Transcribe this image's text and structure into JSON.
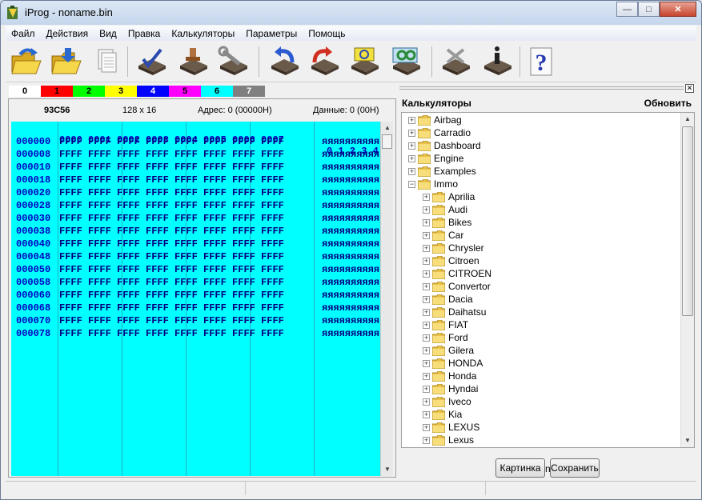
{
  "window": {
    "title": "iProg - noname.bin"
  },
  "menu": [
    "Файл",
    "Действия",
    "Вид",
    "Правка",
    "Калькуляторы",
    "Параметры",
    "Помощь"
  ],
  "toolbar_icons": [
    "open-folder-icon",
    "save-folder-icon",
    "copy-documents-icon",
    "chip-check-icon",
    "chip-stamp-icon",
    "chip-wrench-icon",
    "chip-undo-icon",
    "chip-redo-icon",
    "chip-read-icon",
    "chip-verify-icon",
    "chip-erase-icon",
    "chip-info-icon",
    "help-icon"
  ],
  "colors": [
    {
      "label": "0",
      "bg": "#ffffff",
      "fg": "#000000"
    },
    {
      "label": "1",
      "bg": "#ff0000",
      "fg": "#000000"
    },
    {
      "label": "2",
      "bg": "#00ff00",
      "fg": "#000000"
    },
    {
      "label": "3",
      "bg": "#ffff00",
      "fg": "#000000"
    },
    {
      "label": "4",
      "bg": "#0000ff",
      "fg": "#ffffff"
    },
    {
      "label": "5",
      "bg": "#ff00ff",
      "fg": "#000000"
    },
    {
      "label": "6",
      "bg": "#00ffff",
      "fg": "#000000"
    },
    {
      "label": "7",
      "bg": "#808080",
      "fg": "#ffffff"
    }
  ],
  "hex": {
    "chip": "93C56",
    "size": "128 x 16",
    "address": "Адрес: 0 (00000H)",
    "data": "Данные: 0 (00H)",
    "header": "0000 0001 0002 0003 0004 0005 0006 0007",
    "ascii_header": "0 1 2 3 4",
    "rows": [
      {
        "addr": "000000",
        "cells": "FFFF FFFF FFFF FFFF FFFF FFFF FFFF FFFF",
        "ascii": "яяяяяяяяяя"
      },
      {
        "addr": "000008",
        "cells": "FFFF FFFF FFFF FFFF FFFF FFFF FFFF FFFF",
        "ascii": "яяяяяяяяяя"
      },
      {
        "addr": "000010",
        "cells": "FFFF FFFF FFFF FFFF FFFF FFFF FFFF FFFF",
        "ascii": "яяяяяяяяяя"
      },
      {
        "addr": "000018",
        "cells": "FFFF FFFF FFFF FFFF FFFF FFFF FFFF FFFF",
        "ascii": "яяяяяяяяяя"
      },
      {
        "addr": "000020",
        "cells": "FFFF FFFF FFFF FFFF FFFF FFFF FFFF FFFF",
        "ascii": "яяяяяяяяяя"
      },
      {
        "addr": "000028",
        "cells": "FFFF FFFF FFFF FFFF FFFF FFFF FFFF FFFF",
        "ascii": "яяяяяяяяяя"
      },
      {
        "addr": "000030",
        "cells": "FFFF FFFF FFFF FFFF FFFF FFFF FFFF FFFF",
        "ascii": "яяяяяяяяяя"
      },
      {
        "addr": "000038",
        "cells": "FFFF FFFF FFFF FFFF FFFF FFFF FFFF FFFF",
        "ascii": "яяяяяяяяяя"
      },
      {
        "addr": "000040",
        "cells": "FFFF FFFF FFFF FFFF FFFF FFFF FFFF FFFF",
        "ascii": "яяяяяяяяяя"
      },
      {
        "addr": "000048",
        "cells": "FFFF FFFF FFFF FFFF FFFF FFFF FFFF FFFF",
        "ascii": "яяяяяяяяяя"
      },
      {
        "addr": "000050",
        "cells": "FFFF FFFF FFFF FFFF FFFF FFFF FFFF FFFF",
        "ascii": "яяяяяяяяяя"
      },
      {
        "addr": "000058",
        "cells": "FFFF FFFF FFFF FFFF FFFF FFFF FFFF FFFF",
        "ascii": "яяяяяяяяяя"
      },
      {
        "addr": "000060",
        "cells": "FFFF FFFF FFFF FFFF FFFF FFFF FFFF FFFF",
        "ascii": "яяяяяяяяяя"
      },
      {
        "addr": "000068",
        "cells": "FFFF FFFF FFFF FFFF FFFF FFFF FFFF FFFF",
        "ascii": "яяяяяяяяяя"
      },
      {
        "addr": "000070",
        "cells": "FFFF FFFF FFFF FFFF FFFF FFFF FFFF FFFF",
        "ascii": "яяяяяяяяяя"
      },
      {
        "addr": "000078",
        "cells": "FFFF FFFF FFFF FFFF FFFF FFFF FFFF FFFF",
        "ascii": "яяяяяяяяяя"
      }
    ]
  },
  "calculators": {
    "title": "Калькуляторы",
    "refresh_label": "Обновить",
    "tree": [
      {
        "label": "Airbag",
        "level": 0,
        "expanded": false
      },
      {
        "label": "Carradio",
        "level": 0,
        "expanded": false
      },
      {
        "label": "Dashboard",
        "level": 0,
        "expanded": false
      },
      {
        "label": "Engine",
        "level": 0,
        "expanded": false
      },
      {
        "label": "Examples",
        "level": 0,
        "expanded": false
      },
      {
        "label": "Immo",
        "level": 0,
        "expanded": true
      },
      {
        "label": "Aprilia",
        "level": 1,
        "expanded": false
      },
      {
        "label": "Audi",
        "level": 1,
        "expanded": false
      },
      {
        "label": "Bikes",
        "level": 1,
        "expanded": false
      },
      {
        "label": "Car",
        "level": 1,
        "expanded": false
      },
      {
        "label": "Chrysler",
        "level": 1,
        "expanded": false
      },
      {
        "label": "Citroen",
        "level": 1,
        "expanded": false
      },
      {
        "label": "CITROEN",
        "level": 1,
        "expanded": false
      },
      {
        "label": "Convertor",
        "level": 1,
        "expanded": false
      },
      {
        "label": "Dacia",
        "level": 1,
        "expanded": false
      },
      {
        "label": "Daihatsu",
        "level": 1,
        "expanded": false
      },
      {
        "label": "FIAT",
        "level": 1,
        "expanded": false
      },
      {
        "label": "Ford",
        "level": 1,
        "expanded": false
      },
      {
        "label": "Gilera",
        "level": 1,
        "expanded": false
      },
      {
        "label": "HONDA",
        "level": 1,
        "expanded": false
      },
      {
        "label": "Honda",
        "level": 1,
        "expanded": false
      },
      {
        "label": "Hyndai",
        "level": 1,
        "expanded": false
      },
      {
        "label": "Iveco",
        "level": 1,
        "expanded": false
      },
      {
        "label": "Kia",
        "level": 1,
        "expanded": false
      },
      {
        "label": "LEXUS",
        "level": 1,
        "expanded": false
      },
      {
        "label": "Lexus",
        "level": 1,
        "expanded": false
      }
    ],
    "picture_button": "Картинка",
    "save_button": "Сохранить",
    "hidden_glyph": "n"
  }
}
